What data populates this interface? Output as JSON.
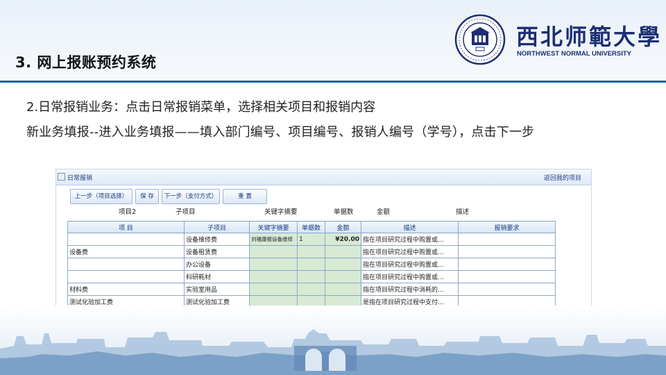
{
  "slide": {
    "title": "3. 网上报账预约系统",
    "line1": "2.日常报销业务：点击日常报销菜单，选择相关项目和报销内容",
    "line2": "新业务填报--进入业务填报——填入部门编号、项目编号、报销人编号（学号），点击下一步"
  },
  "logo": {
    "cn": "西北师範大學",
    "en": "NORTHWEST NORMAL UNIVERSITY"
  },
  "app": {
    "header_title": "日常报销",
    "back_link": "返回我的项目",
    "toolbar": {
      "prev": "上一步（项目选择）",
      "save": "保 存",
      "next": "下一步（支付方式）",
      "reset": "重 置"
    },
    "labels": {
      "project": "项目2",
      "subproject": "子项目",
      "keyword": "关键字摘要",
      "count": "单据数",
      "amount": "金额",
      "desc": "描述"
    },
    "table": {
      "headers": [
        "项 目",
        "子项目",
        "关键字摘要",
        "单据数",
        "金额",
        "描述",
        "报销要求"
      ],
      "rows": [
        {
          "item": "",
          "sub": "设备维修费",
          "keyword": "刘福康报设备维修",
          "count": "1",
          "amount": "¥20.00",
          "desc": "指在项目研究过程中购置或...",
          "req": ""
        },
        {
          "item": "设备费",
          "sub": "设备租赁费",
          "keyword": "",
          "count": "",
          "amount": "",
          "desc": "指在项目研究过程中购置或...",
          "req": ""
        },
        {
          "item": "",
          "sub": "办公设备",
          "keyword": "",
          "count": "",
          "amount": "",
          "desc": "指在项目研究过程中购置或...",
          "req": ""
        },
        {
          "item": "",
          "sub": "科研耗材",
          "keyword": "",
          "count": "",
          "amount": "",
          "desc": "指在项目研究过程中购置或...",
          "req": ""
        },
        {
          "item": "材料费",
          "sub": "实验室用品",
          "keyword": "",
          "count": "",
          "amount": "",
          "desc": "指在项目研究过程中消耗的...",
          "req": ""
        },
        {
          "item": "测试化验加工费",
          "sub": "测试化验加工费",
          "keyword": "",
          "count": "",
          "amount": "",
          "desc": "是指在项目研究过程中支付...",
          "req": ""
        }
      ]
    }
  },
  "colors": {
    "title_rule": "#1f5fa8",
    "logo_blue": "#1c2f73",
    "input_green": "#d7ead3",
    "app_link": "#1a3c82"
  }
}
